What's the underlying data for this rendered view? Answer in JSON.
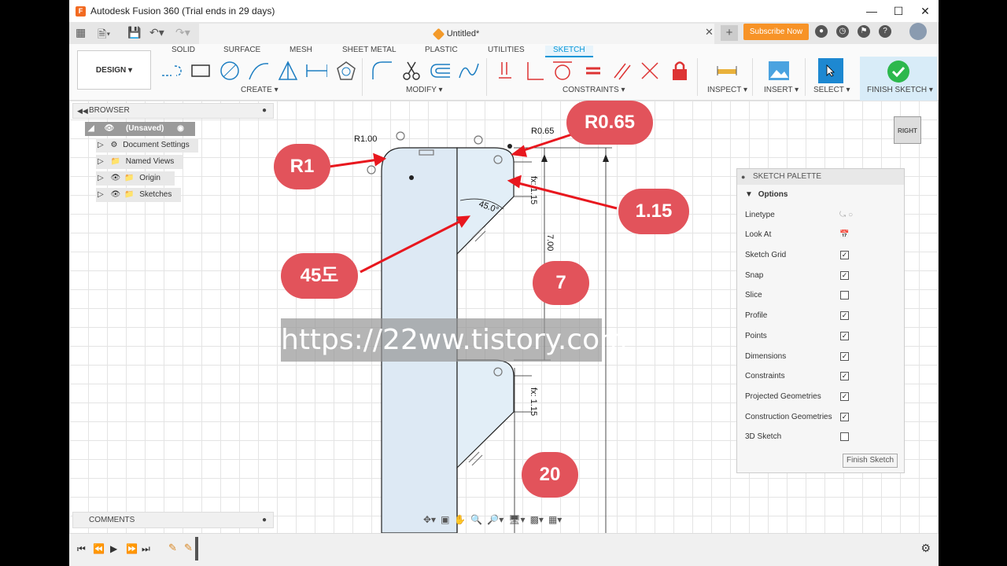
{
  "window": {
    "title": "Autodesk Fusion 360 (Trial ends in 29 days)",
    "app_logo": "F"
  },
  "doc_tab": {
    "title": "Untitled*"
  },
  "header": {
    "subscribe_label": "Subscribe Now"
  },
  "ribbon": {
    "workspace": "DESIGN ▾",
    "tabs": [
      "SOLID",
      "SURFACE",
      "MESH",
      "SHEET METAL",
      "PLASTIC",
      "UTILITIES",
      "SKETCH"
    ],
    "groups": {
      "create": "CREATE ▾",
      "modify": "MODIFY ▾",
      "constraints": "CONSTRAINTS ▾",
      "inspect": "INSPECT ▾",
      "insert": "INSERT ▾",
      "select": "SELECT ▾",
      "finish": "FINISH SKETCH ▾"
    }
  },
  "browser": {
    "title": "BROWSER",
    "items": [
      {
        "label": "(Unsaved)"
      },
      {
        "label": "Document Settings"
      },
      {
        "label": "Named Views"
      },
      {
        "label": "Origin"
      },
      {
        "label": "Sketches"
      }
    ]
  },
  "comments": {
    "title": "COMMENTS"
  },
  "palette": {
    "title": "SKETCH PALETTE",
    "section": "Options",
    "rows": [
      {
        "label": "Linetype",
        "checked": null
      },
      {
        "label": "Look At",
        "checked": null
      },
      {
        "label": "Sketch Grid",
        "checked": true
      },
      {
        "label": "Snap",
        "checked": true
      },
      {
        "label": "Slice",
        "checked": false
      },
      {
        "label": "Profile",
        "checked": true
      },
      {
        "label": "Points",
        "checked": true
      },
      {
        "label": "Dimensions",
        "checked": true
      },
      {
        "label": "Constraints",
        "checked": true
      },
      {
        "label": "Projected Geometries",
        "checked": true
      },
      {
        "label": "Construction Geometries",
        "checked": true
      },
      {
        "label": "3D Sketch",
        "checked": false
      }
    ],
    "finish_button": "Finish Sketch"
  },
  "viewcube": {
    "label": "RIGHT"
  },
  "sketch": {
    "dims": {
      "r1": "R1.00",
      "r065": "R0.65",
      "angle": "45.0°",
      "fx1": "fx: 1.15",
      "d7": "7.00",
      "fx2": "fx: 1.15"
    }
  },
  "annotations": {
    "r1": "R1",
    "r065": "R0.65",
    "v115": "1.15",
    "deg45": "45도",
    "seven": "7",
    "twenty": "20"
  },
  "watermark": "https://22ww.tistory.com",
  "colors": {
    "accent": "#0696d7",
    "badge": "#e2535b",
    "subscribe": "#f79327",
    "finish": "#2db84d"
  }
}
